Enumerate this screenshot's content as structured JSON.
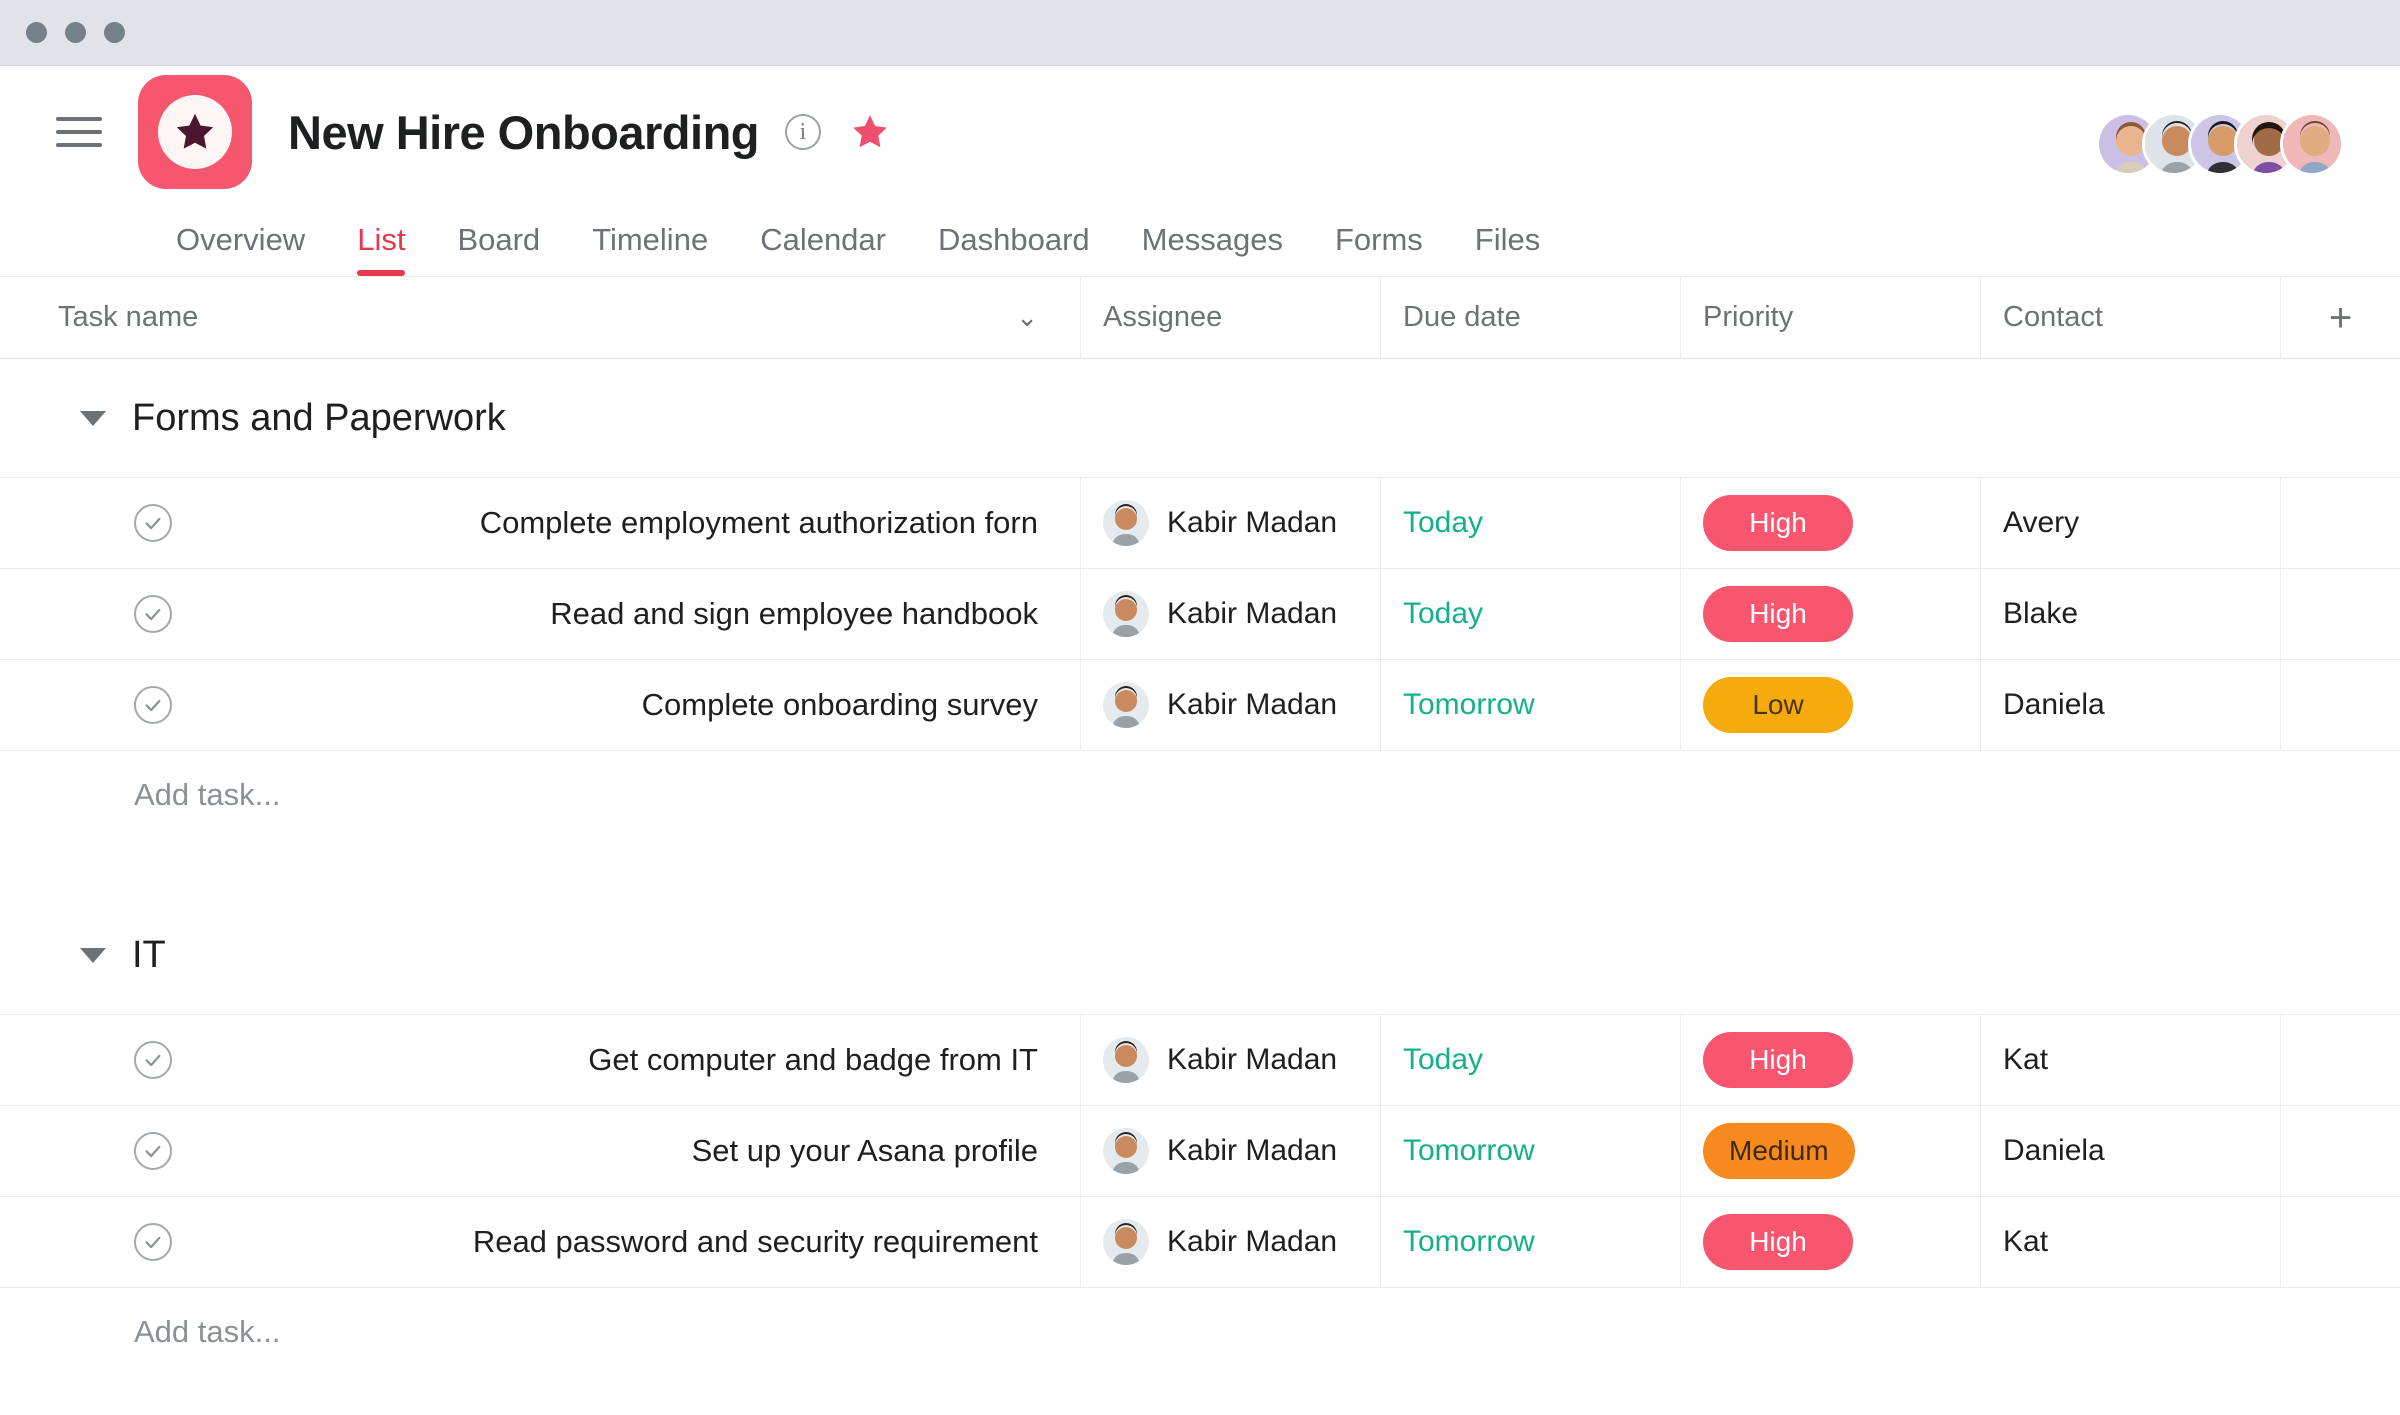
{
  "window": {
    "traffic_lights": [
      "close",
      "minimize",
      "maximize"
    ]
  },
  "header": {
    "menu_icon": "hamburger-icon",
    "project_icon": "star-badge-icon",
    "title": "New Hire Onboarding",
    "info_icon": "i",
    "info_icon_name": "info-circle-icon",
    "favorite_icon": "star-icon",
    "members": [
      {
        "name": "member-1",
        "bg": "#cbbfe6",
        "skin": "#e8b58f",
        "hair": "#8a5a34"
      },
      {
        "name": "member-2",
        "bg": "#dde3e9",
        "skin": "#c98a5e",
        "hair": "#2b2118"
      },
      {
        "name": "member-3",
        "bg": "#ccc5e8",
        "skin": "#d89b6a",
        "hair": "#1d1b18"
      },
      {
        "name": "member-4",
        "bg": "#edd2cf",
        "skin": "#a06b45",
        "hair": "#23160f"
      },
      {
        "name": "member-5",
        "bg": "#f0b7b9",
        "skin": "#e0ab80",
        "hair": "#6d4a2a"
      }
    ]
  },
  "tabs": [
    {
      "label": "Overview",
      "active": false
    },
    {
      "label": "List",
      "active": true
    },
    {
      "label": "Board",
      "active": false
    },
    {
      "label": "Timeline",
      "active": false
    },
    {
      "label": "Calendar",
      "active": false
    },
    {
      "label": "Dashboard",
      "active": false
    },
    {
      "label": "Messages",
      "active": false
    },
    {
      "label": "Forms",
      "active": false
    },
    {
      "label": "Files",
      "active": false
    }
  ],
  "table": {
    "columns": [
      {
        "label": "Task name",
        "key": "task_name"
      },
      {
        "label": "Assignee",
        "key": "assignee"
      },
      {
        "label": "Due date",
        "key": "due_date"
      },
      {
        "label": "Priority",
        "key": "priority"
      },
      {
        "label": "Contact",
        "key": "contact"
      }
    ],
    "sort_icon": "chevron-down-icon",
    "add_column_icon": "+",
    "add_task_label": "Add task...",
    "sections": [
      {
        "name": "Forms and Paperwork",
        "collapse_icon": "caret-down-icon",
        "tasks": [
          {
            "name": "Complete employment authorization forn",
            "assignee": "Kabir Madan",
            "due_date": "Today",
            "priority": "High",
            "priority_level": "high",
            "contact": "Avery"
          },
          {
            "name": "Read and sign employee handbook",
            "assignee": "Kabir Madan",
            "due_date": "Today",
            "priority": "High",
            "priority_level": "high",
            "contact": "Blake"
          },
          {
            "name": "Complete onboarding survey",
            "assignee": "Kabir Madan",
            "due_date": "Tomorrow",
            "priority": "Low",
            "priority_level": "low",
            "contact": "Daniela"
          }
        ]
      },
      {
        "name": "IT",
        "collapse_icon": "caret-down-icon",
        "tasks": [
          {
            "name": "Get computer and badge from IT",
            "assignee": "Kabir Madan",
            "due_date": "Today",
            "priority": "High",
            "priority_level": "high",
            "contact": "Kat"
          },
          {
            "name": "Set up your Asana profile",
            "assignee": "Kabir Madan",
            "due_date": "Tomorrow",
            "priority": "Medium",
            "priority_level": "medium",
            "contact": "Daniela"
          },
          {
            "name": "Read password and security requirement",
            "assignee": "Kabir Madan",
            "due_date": "Tomorrow",
            "priority": "High",
            "priority_level": "high",
            "contact": "Kat"
          }
        ]
      }
    ]
  },
  "colors": {
    "accent": "#e8384f",
    "project_icon_bg": "#f4576e",
    "due_date": "#14b08a",
    "priority_high": "#f8556e",
    "priority_medium": "#f68a1e",
    "priority_low": "#f5ab0e",
    "titlebar": "#e2e3e8"
  }
}
